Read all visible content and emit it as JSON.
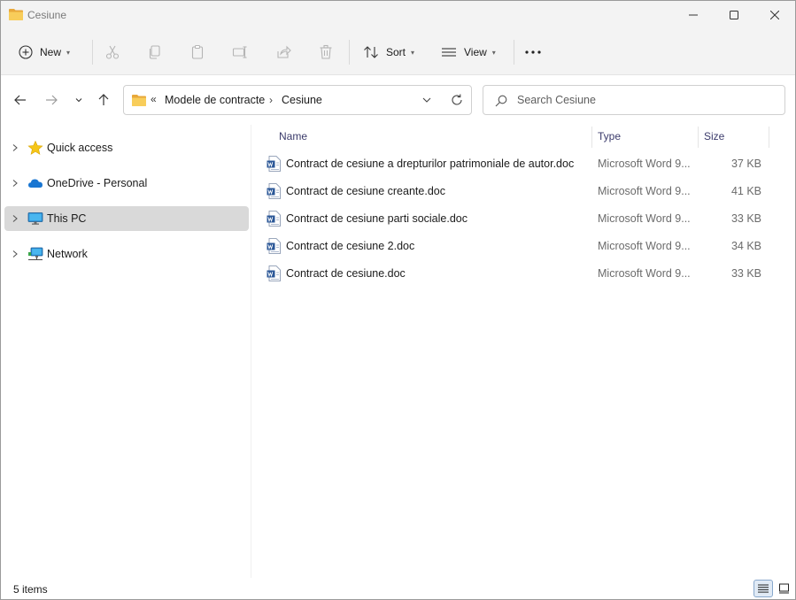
{
  "window": {
    "title": "Cesiune"
  },
  "toolbar": {
    "new_label": "New",
    "sort_label": "Sort",
    "view_label": "View"
  },
  "address": {
    "overflow": "«",
    "crumbs": [
      "Modele de contracte",
      "Cesiune"
    ],
    "separator": "›"
  },
  "search": {
    "placeholder": "Search Cesiune"
  },
  "sidebar": {
    "items": [
      {
        "label": "Quick access",
        "icon": "star-icon"
      },
      {
        "label": "OneDrive - Personal",
        "icon": "cloud-icon"
      },
      {
        "label": "This PC",
        "icon": "monitor-icon",
        "selected": true
      },
      {
        "label": "Network",
        "icon": "network-icon"
      }
    ]
  },
  "columns": {
    "name": "Name",
    "type": "Type",
    "size": "Size"
  },
  "files": [
    {
      "name": "Contract de cesiune a drepturilor patrimoniale de autor.doc",
      "type": "Microsoft Word 9...",
      "size": "37 KB"
    },
    {
      "name": "Contract de cesiune creante.doc",
      "type": "Microsoft Word 9...",
      "size": "41 KB"
    },
    {
      "name": "Contract de cesiune parti sociale.doc",
      "type": "Microsoft Word 9...",
      "size": "33 KB"
    },
    {
      "name": "Contract de cesiune 2.doc",
      "type": "Microsoft Word 9...",
      "size": "34 KB"
    },
    {
      "name": "Contract de cesiune.doc",
      "type": "Microsoft Word 9...",
      "size": "33 KB"
    }
  ],
  "status": {
    "count": "5 items"
  },
  "colors": {
    "selection": "#d9d9d9",
    "folder": "#f6c44f",
    "word_blue": "#2b5797",
    "accent": "#0067c0"
  }
}
